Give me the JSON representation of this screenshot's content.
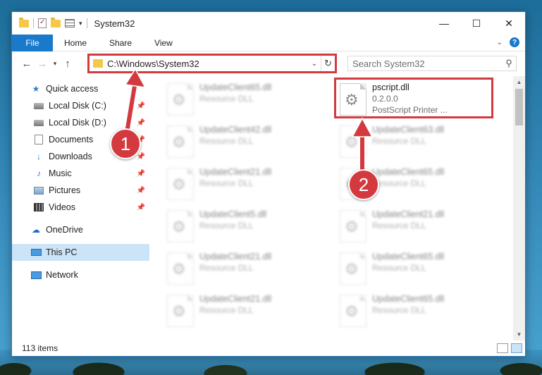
{
  "window": {
    "title": "System32",
    "quick_access_toolbar": [
      "folder-icon",
      "properties-icon",
      "new-folder-icon",
      "view-icon"
    ],
    "controls": {
      "minimize": "—",
      "maximize": "☐",
      "close": "✕"
    }
  },
  "ribbon": {
    "tabs": [
      {
        "label": "File",
        "active": true
      },
      {
        "label": "Home"
      },
      {
        "label": "Share"
      },
      {
        "label": "View"
      }
    ]
  },
  "address": {
    "path": "C:\\Windows\\System32",
    "back": "←",
    "forward": "→",
    "recent": "▾",
    "up": "↑",
    "refresh": "↻"
  },
  "search": {
    "placeholder": "Search System32"
  },
  "nav": {
    "quick_access": "Quick access",
    "items": [
      {
        "label": "Local Disk (C:)",
        "icon": "disk-icon"
      },
      {
        "label": "Local Disk (D:)",
        "icon": "disk-icon"
      },
      {
        "label": "Documents",
        "icon": "documents-icon"
      },
      {
        "label": "Downloads",
        "icon": "download-icon"
      },
      {
        "label": "Music",
        "icon": "music-icon"
      },
      {
        "label": "Pictures",
        "icon": "pictures-icon"
      },
      {
        "label": "Videos",
        "icon": "videos-icon"
      }
    ],
    "onedrive": "OneDrive",
    "this_pc": "This PC",
    "network": "Network"
  },
  "files": {
    "left_column": [
      {
        "name": "UpdateClient65.dll",
        "type": "Resource DLL"
      },
      {
        "name": "UpdateClient42.dll",
        "type": "Resource DLL"
      },
      {
        "name": "UpdateClient21.dll",
        "type": "Resource DLL"
      },
      {
        "name": "UpdateClient5.dll",
        "type": "Resource DLL"
      },
      {
        "name": "UpdateClient21.dll",
        "type": "Resource DLL"
      },
      {
        "name": "UpdateClient21.dll",
        "type": "Resource DLL"
      }
    ],
    "right_column": [
      {
        "name": "pscript.dll",
        "version": "0.2.0.0",
        "type": "PostScript Printer ..."
      },
      {
        "name": "UpdateClient63.dll",
        "type": "Resource DLL"
      },
      {
        "name": "UpdateClient65.dll",
        "type": "Resource DLL"
      },
      {
        "name": "UpdateClient21.dll",
        "type": "Resource DLL"
      },
      {
        "name": "UpdateClient65.dll",
        "type": "Resource DLL"
      },
      {
        "name": "UpdateClient65.dll",
        "type": "Resource DLL"
      }
    ]
  },
  "status": {
    "item_count": "113 items"
  },
  "callouts": {
    "step1": "1",
    "step2": "2",
    "color": "#d33a3f"
  }
}
